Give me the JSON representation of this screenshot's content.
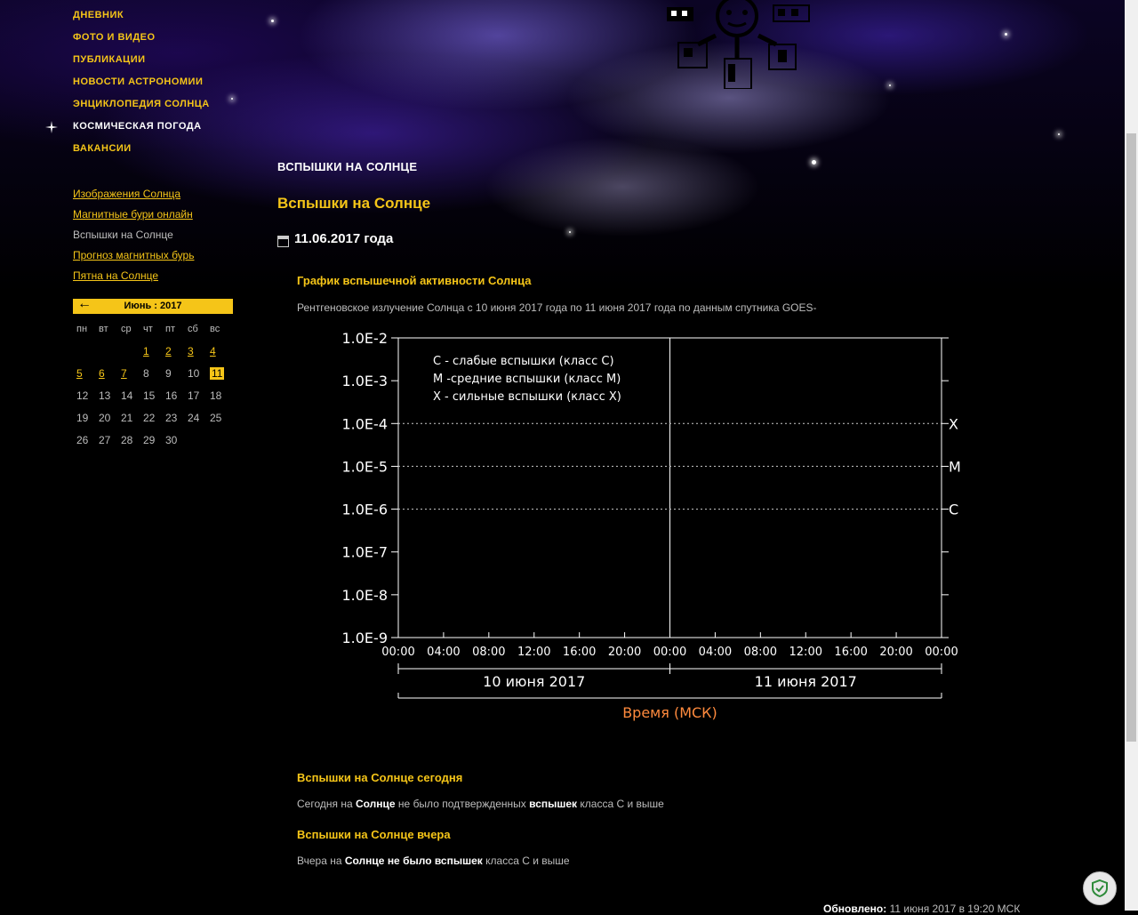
{
  "main_nav": [
    {
      "label": "Дневник",
      "active": false
    },
    {
      "label": "Фото и видео",
      "active": false
    },
    {
      "label": "Публикации",
      "active": false
    },
    {
      "label": "Новости астрономии",
      "active": false
    },
    {
      "label": "Энциклопедия Солнца",
      "active": false
    },
    {
      "label": "Космическая погода",
      "active": true
    },
    {
      "label": "Вакансии",
      "active": false
    }
  ],
  "sub_nav": {
    "links": [
      "Изображения Солнца",
      "Магнитные бури онлайн"
    ],
    "current": "Вспышки на Солнце",
    "links_after": [
      "Прогноз магнитных бурь",
      "Пятна на Солнце"
    ]
  },
  "calendar": {
    "prev_arrow": "←",
    "month_label": "Июнь : 2017",
    "weekdays": [
      "пн",
      "вт",
      "ср",
      "чт",
      "пт",
      "сб",
      "вс"
    ],
    "days": [
      [
        "",
        "",
        "",
        "1",
        "2",
        "3",
        "4"
      ],
      [
        "5",
        "6",
        "7",
        "8",
        "9",
        "10",
        "11"
      ],
      [
        "12",
        "13",
        "14",
        "15",
        "16",
        "17",
        "18"
      ],
      [
        "19",
        "20",
        "21",
        "22",
        "23",
        "24",
        "25"
      ],
      [
        "26",
        "27",
        "28",
        "29",
        "30",
        "",
        ""
      ]
    ],
    "linked_days": [
      "1",
      "2",
      "3",
      "4",
      "5",
      "6",
      "7"
    ],
    "today": "11"
  },
  "section_caption": "Вспышки на Солнце",
  "page_title": "Вспышки на Солнце",
  "date": "11.06.2017 года",
  "chart_heading": "График вспышечной активности Солнца",
  "chart_description": "Рентгеновское излучение Солнца с 10 июня 2017 года по 11 июня 2017 года по данным спутника GOES-",
  "chart_data": {
    "type": "line",
    "title": "",
    "xlabel": "Время (МСК)",
    "ylabel": "",
    "y_scale": "log",
    "y_ticks": [
      "1.0E-2",
      "1.0E-3",
      "1.0E-4",
      "1.0E-5",
      "1.0E-6",
      "1.0E-7",
      "1.0E-8",
      "1.0E-9"
    ],
    "x_ticks": [
      "00:00",
      "04:00",
      "08:00",
      "12:00",
      "16:00",
      "20:00",
      "00:00",
      "04:00",
      "08:00",
      "12:00",
      "16:00",
      "20:00",
      "00:00"
    ],
    "day_labels": [
      "10 июня 2017",
      "11 июня 2017"
    ],
    "class_thresholds": [
      {
        "label": "X",
        "value": "1.0E-4"
      },
      {
        "label": "M",
        "value": "1.0E-5"
      },
      {
        "label": "C",
        "value": "1.0E-6"
      }
    ],
    "legend": [
      "C - слабые вспышки (класс С)",
      "M -средние вспышки (класс М)",
      "X - сильные вспышки (класс Х)"
    ],
    "legend_position": "top-left",
    "series": []
  },
  "today_heading": "Вспышки на Солнце сегодня",
  "today_text": {
    "p1": "Сегодня на ",
    "b1": "Солнце",
    "p2": " не было подтвержденных ",
    "b2": "вспышек",
    "p3": " класса С и выше"
  },
  "yesterday_heading": "Вспышки на Солнце вчера",
  "yesterday_text": {
    "p1": "Вчера на ",
    "b1": "Солнце не было вспышек",
    "p2": " класса С и выше"
  },
  "updated": {
    "label": "Обновлено:",
    "value": " 11 июня 2017 в 19:20 МСК"
  },
  "colors": {
    "accent": "#f5c518",
    "background": "#000000",
    "text": "#bdbdbd",
    "xlabel": "#ff8a3d"
  },
  "icons": [
    "star-icon",
    "calendar-icon",
    "shield-icon",
    "arrow-left-icon"
  ]
}
